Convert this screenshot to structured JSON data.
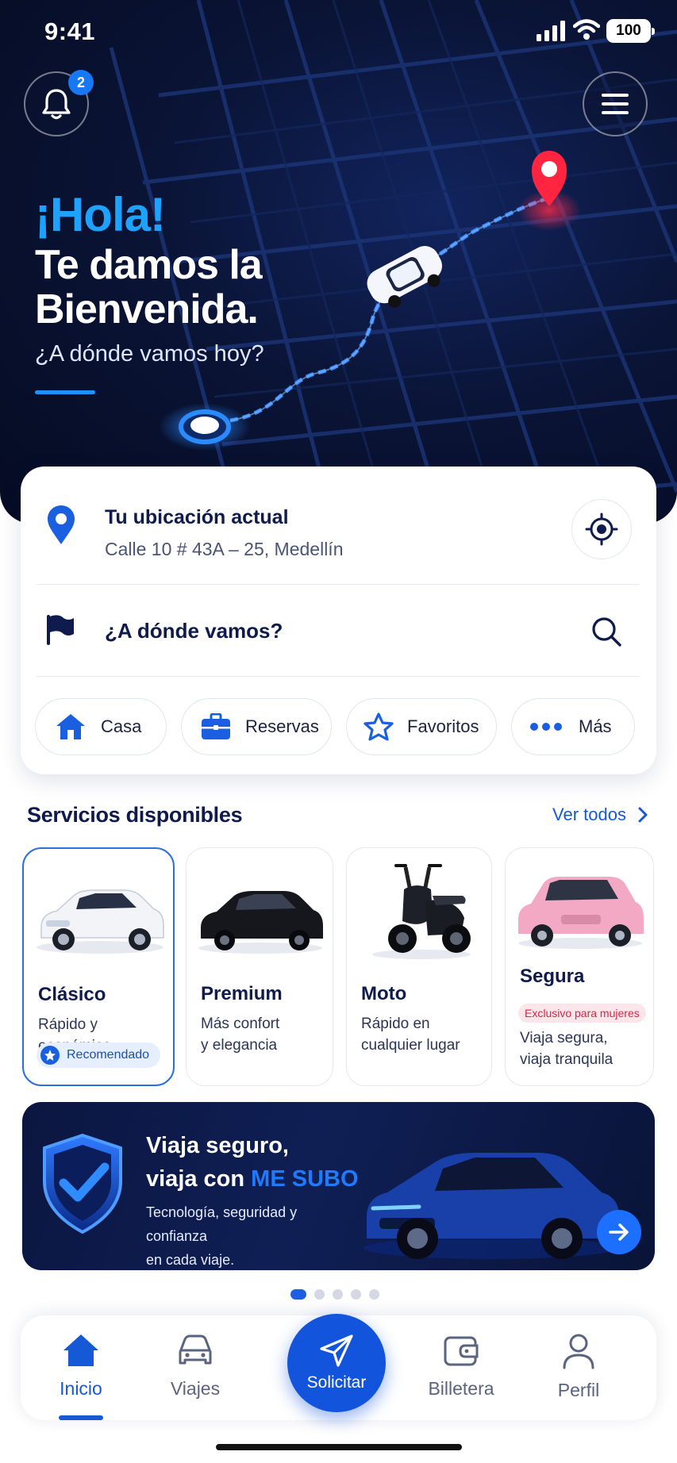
{
  "status_bar": {
    "time": "9:41",
    "battery": "100"
  },
  "header": {
    "notification_count": "2",
    "greeting": "¡Hola!",
    "welcome": "Te damos la Bienvenida.",
    "question": "¿A dónde vamos hoy?"
  },
  "location": {
    "title": "Tu ubicación actual",
    "address": "Calle 10 # 43A – 25, Medellín",
    "destination_placeholder": "¿A dónde vamos?"
  },
  "quick_actions": [
    {
      "label": "Casa",
      "icon": "home-icon"
    },
    {
      "label": "Reservas",
      "icon": "briefcase-icon"
    },
    {
      "label": "Favoritos",
      "icon": "star-icon"
    },
    {
      "label": "Más",
      "icon": "more-dots-icon"
    }
  ],
  "services": {
    "title": "Servicios disponibles",
    "see_all": "Ver todos",
    "items": [
      {
        "name": "Clásico",
        "desc1": "Rápido y económico",
        "desc2": "",
        "badge": "Recomendado",
        "selected": true
      },
      {
        "name": "Premium",
        "desc1": "Más confort",
        "desc2": "y elegancia"
      },
      {
        "name": "Moto",
        "desc1": "Rápido en",
        "desc2": "cualquier lugar"
      },
      {
        "name": "Segura",
        "tag": "Exclusivo para mujeres",
        "desc1": "Viaja segura,",
        "desc2": "viaja tranquila"
      }
    ]
  },
  "banner": {
    "line1": "Viaja seguro,",
    "line2_prefix": "viaja con ",
    "line2_brand": "ME SUBO",
    "sub1": "Tecnología, seguridad y confianza",
    "sub2": "en cada viaje."
  },
  "carousel": {
    "pages": 5,
    "active": 1
  },
  "bottom_nav": {
    "items": [
      {
        "label": "Inicio",
        "icon": "home-icon",
        "active": true
      },
      {
        "label": "Viajes",
        "icon": "car-icon"
      },
      {
        "label": "Solicitar",
        "icon": "send-icon"
      },
      {
        "label": "Billetera",
        "icon": "wallet-icon"
      },
      {
        "label": "Perfil",
        "icon": "user-icon"
      }
    ]
  },
  "colors": {
    "primary": "#1354dc",
    "accent": "#1ea2ff",
    "navy": "#0f1b4d",
    "hero_bg": "#0a1436",
    "danger": "#e8203a"
  }
}
